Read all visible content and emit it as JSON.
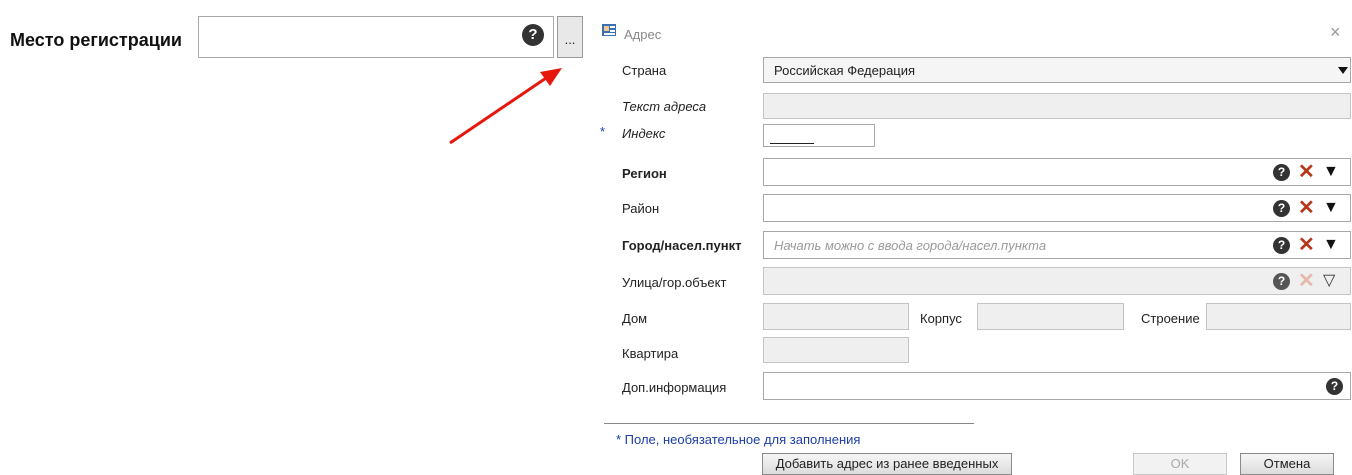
{
  "registration": {
    "label": "Место регистрации",
    "help_icon": "help-icon",
    "dots_label": "..."
  },
  "dialog": {
    "title": "Адрес",
    "close_glyph": "×",
    "fields": {
      "country": {
        "label": "Страна",
        "value": "Российская Федерация"
      },
      "address_text": {
        "label": "Текст адреса"
      },
      "index": {
        "star": "*",
        "label": "Индекс"
      },
      "region": {
        "label": "Регион"
      },
      "district": {
        "label": "Район"
      },
      "city": {
        "label": "Город/насел.пункт",
        "placeholder": "Начать можно с ввода города/насел.пункта"
      },
      "street": {
        "label": "Улица/гор.объект"
      },
      "house": {
        "label": "Дом"
      },
      "building": {
        "label": "Корпус"
      },
      "structure": {
        "label": "Строение"
      },
      "apartment": {
        "label": "Квартира"
      },
      "extra": {
        "label": "Доп.информация"
      }
    },
    "note": "*  Поле, необязательное для заполнения",
    "buttons": {
      "add_previous": "Добавить адрес из ранее введенных",
      "ok": "OK",
      "cancel": "Отмена"
    }
  },
  "colors": {
    "arrow": "#e8170c",
    "note": "#1a3ea8",
    "clear_icon": "#b5381a"
  }
}
